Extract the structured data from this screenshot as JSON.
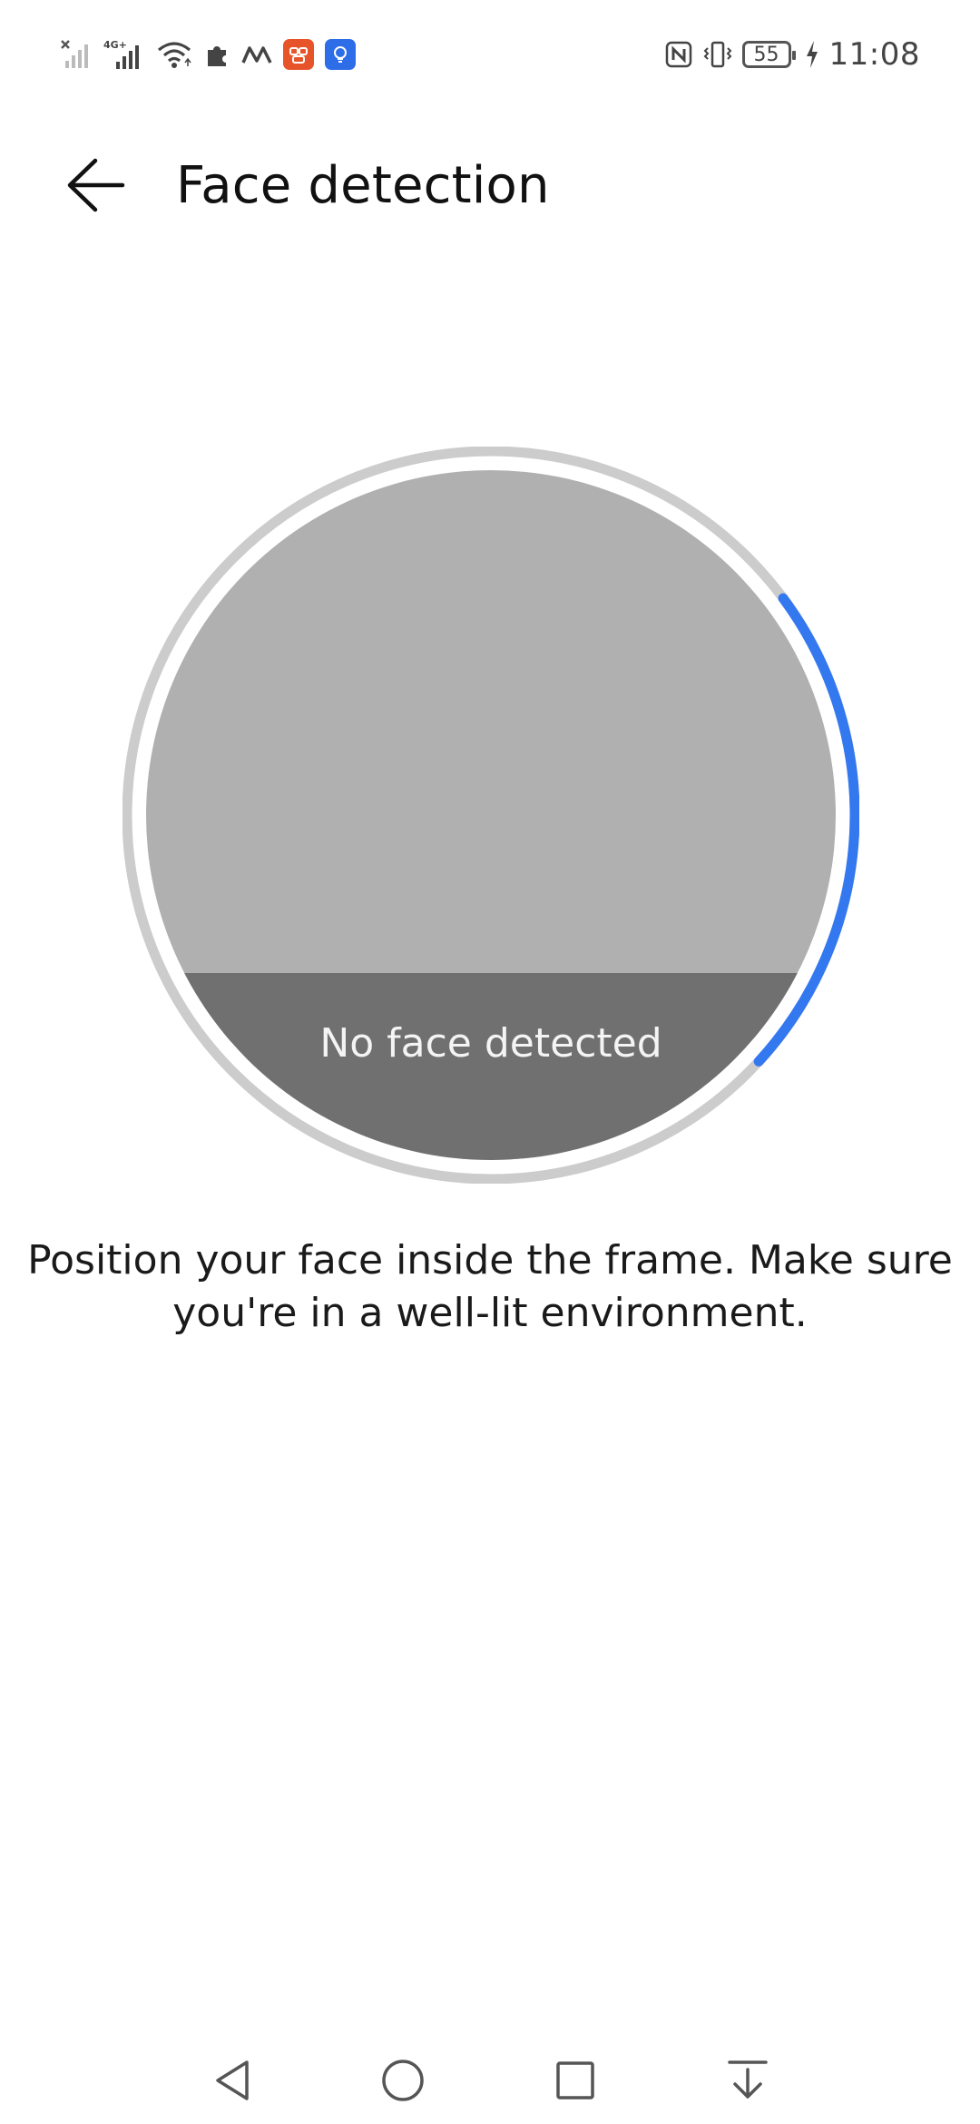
{
  "status_bar": {
    "time": "11:08",
    "battery_level": "55",
    "network_label": "4G+",
    "icons": [
      "signal-off-icon",
      "signal-4g-icon",
      "wifi-icon",
      "puzzle-icon",
      "m-logo-icon",
      "app-notification-icon",
      "lightbulb-app-icon",
      "nfc-icon",
      "vibrate-icon",
      "battery-icon",
      "charging-icon"
    ]
  },
  "header": {
    "title": "Face detection",
    "back_icon": "back-arrow-icon"
  },
  "camera": {
    "status_text": "No face detected",
    "progress": 0.22,
    "colors": {
      "ring_track": "#cccccc",
      "ring_progress": "#3478f0",
      "preview": "#b0b0b0",
      "overlay": "#707070"
    }
  },
  "instructions": {
    "text": "Position your face inside the frame. Make sure you're in a well-lit environment."
  },
  "nav_bar": {
    "icons": [
      "nav-back-icon",
      "nav-home-icon",
      "nav-recents-icon",
      "nav-notification-icon"
    ]
  }
}
